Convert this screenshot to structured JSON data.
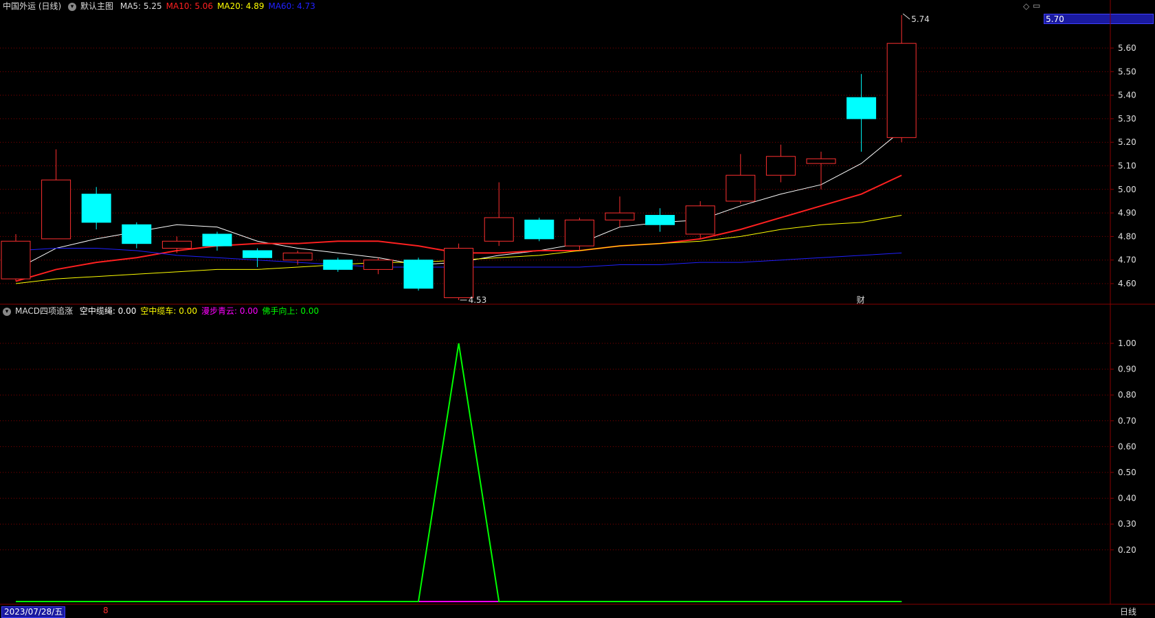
{
  "price_panel": {
    "stock_name": "中国外运 (日线)",
    "template": "默认主图",
    "ma": [
      {
        "label": "MA5:",
        "value": "5.25",
        "color": "#ffffff"
      },
      {
        "label": "MA10:",
        "value": "5.06",
        "color": "#ff2020"
      },
      {
        "label": "MA20:",
        "value": "4.89",
        "color": "#ffff00"
      },
      {
        "label": "MA60:",
        "value": "4.73",
        "color": "#2020ff"
      }
    ],
    "current_price_tag": "5.70",
    "high_label": "5.74",
    "low_label": "4.53",
    "finance_marker": "财",
    "axis_ticks": [
      "5.60",
      "5.50",
      "5.40",
      "5.30",
      "5.20",
      "5.10",
      "5.00",
      "4.90",
      "4.80",
      "4.70",
      "4.60"
    ]
  },
  "indicator_panel": {
    "name": "MACD四项追涨",
    "items": [
      {
        "label": "空中缆绳:",
        "value": "0.00",
        "color": "#ffffff"
      },
      {
        "label": "空中缆车:",
        "value": "0.00",
        "color": "#ffff00"
      },
      {
        "label": "漫步青云:",
        "value": "0.00",
        "color": "#ff00ff"
      },
      {
        "label": "佛手向上:",
        "value": "0.00",
        "color": "#00ff00"
      }
    ],
    "axis_ticks": [
      "1.00",
      "0.90",
      "0.80",
      "0.70",
      "0.60",
      "0.50",
      "0.40",
      "0.30",
      "0.20"
    ]
  },
  "footer": {
    "date": "2023/07/28/五",
    "marker": "8",
    "period": "日线"
  },
  "colors": {
    "up": "#ff3030",
    "down": "#00ffff",
    "grid": "#8a0000",
    "indicator_line": "#00ff00",
    "indicator_base": "#ff00ff"
  },
  "chart_data": [
    {
      "type": "candlestick",
      "title": "中国外运 (日线)",
      "ylim": [
        4.5,
        5.75
      ],
      "candles": [
        {
          "o": 4.62,
          "c": 4.78,
          "h": 4.81,
          "l": 4.61
        },
        {
          "o": 4.79,
          "c": 5.04,
          "h": 5.17,
          "l": 4.79
        },
        {
          "o": 4.98,
          "c": 4.86,
          "h": 5.01,
          "l": 4.83
        },
        {
          "o": 4.85,
          "c": 4.77,
          "h": 4.86,
          "l": 4.75
        },
        {
          "o": 4.75,
          "c": 4.78,
          "h": 4.8,
          "l": 4.73
        },
        {
          "o": 4.81,
          "c": 4.76,
          "h": 4.82,
          "l": 4.74
        },
        {
          "o": 4.74,
          "c": 4.71,
          "h": 4.75,
          "l": 4.67
        },
        {
          "o": 4.7,
          "c": 4.73,
          "h": 4.74,
          "l": 4.68
        },
        {
          "o": 4.7,
          "c": 4.66,
          "h": 4.71,
          "l": 4.65
        },
        {
          "o": 4.66,
          "c": 4.7,
          "h": 4.71,
          "l": 4.64
        },
        {
          "o": 4.7,
          "c": 4.58,
          "h": 4.71,
          "l": 4.57
        },
        {
          "o": 4.54,
          "c": 4.75,
          "h": 4.77,
          "l": 4.53
        },
        {
          "o": 4.78,
          "c": 4.88,
          "h": 5.03,
          "l": 4.76
        },
        {
          "o": 4.87,
          "c": 4.79,
          "h": 4.88,
          "l": 4.78
        },
        {
          "o": 4.76,
          "c": 4.87,
          "h": 4.88,
          "l": 4.74
        },
        {
          "o": 4.87,
          "c": 4.9,
          "h": 4.97,
          "l": 4.84
        },
        {
          "o": 4.89,
          "c": 4.85,
          "h": 4.92,
          "l": 4.82
        },
        {
          "o": 4.81,
          "c": 4.93,
          "h": 4.95,
          "l": 4.79
        },
        {
          "o": 4.95,
          "c": 5.06,
          "h": 5.15,
          "l": 4.94
        },
        {
          "o": 5.06,
          "c": 5.14,
          "h": 5.19,
          "l": 5.03
        },
        {
          "o": 5.11,
          "c": 5.13,
          "h": 5.16,
          "l": 5.0
        },
        {
          "o": 5.39,
          "c": 5.3,
          "h": 5.49,
          "l": 5.16
        },
        {
          "o": 5.22,
          "c": 5.62,
          "h": 5.74,
          "l": 5.2
        }
      ],
      "series": [
        {
          "name": "MA5",
          "values": [
            4.66,
            4.75,
            4.79,
            4.82,
            4.85,
            4.84,
            4.78,
            4.75,
            4.73,
            4.71,
            4.68,
            4.69,
            4.72,
            4.74,
            4.77,
            4.84,
            4.86,
            4.87,
            4.93,
            4.98,
            5.02,
            5.11,
            5.25
          ]
        },
        {
          "name": "MA10",
          "values": [
            4.61,
            4.66,
            4.69,
            4.71,
            4.74,
            4.76,
            4.77,
            4.77,
            4.78,
            4.78,
            4.76,
            4.73,
            4.73,
            4.74,
            4.74,
            4.76,
            4.77,
            4.79,
            4.83,
            4.88,
            4.93,
            4.98,
            5.06
          ]
        },
        {
          "name": "MA20",
          "values": [
            4.6,
            4.62,
            4.63,
            4.64,
            4.65,
            4.66,
            4.66,
            4.67,
            4.68,
            4.69,
            4.69,
            4.7,
            4.71,
            4.72,
            4.74,
            4.76,
            4.77,
            4.78,
            4.8,
            4.83,
            4.85,
            4.86,
            4.89
          ]
        },
        {
          "name": "MA60",
          "values": [
            4.74,
            4.75,
            4.75,
            4.74,
            4.72,
            4.71,
            4.7,
            4.69,
            4.68,
            4.67,
            4.67,
            4.67,
            4.67,
            4.67,
            4.67,
            4.68,
            4.68,
            4.69,
            4.69,
            4.7,
            4.71,
            4.72,
            4.73
          ]
        }
      ]
    },
    {
      "type": "line",
      "title": "MACD四项追涨",
      "ylim": [
        0,
        1.05
      ],
      "series": [
        {
          "name": "佛手向上",
          "values": [
            0,
            0,
            0,
            0,
            0,
            0,
            0,
            0,
            0,
            0,
            0,
            1,
            0,
            0,
            0,
            0,
            0,
            0,
            0,
            0,
            0,
            0,
            0
          ]
        },
        {
          "name": "漫步青云",
          "values": [
            0,
            0,
            0,
            0,
            0,
            0,
            0,
            0,
            0,
            0,
            0,
            0,
            0,
            0,
            0,
            0,
            0,
            0,
            0,
            0,
            0,
            0,
            0
          ]
        }
      ]
    }
  ]
}
